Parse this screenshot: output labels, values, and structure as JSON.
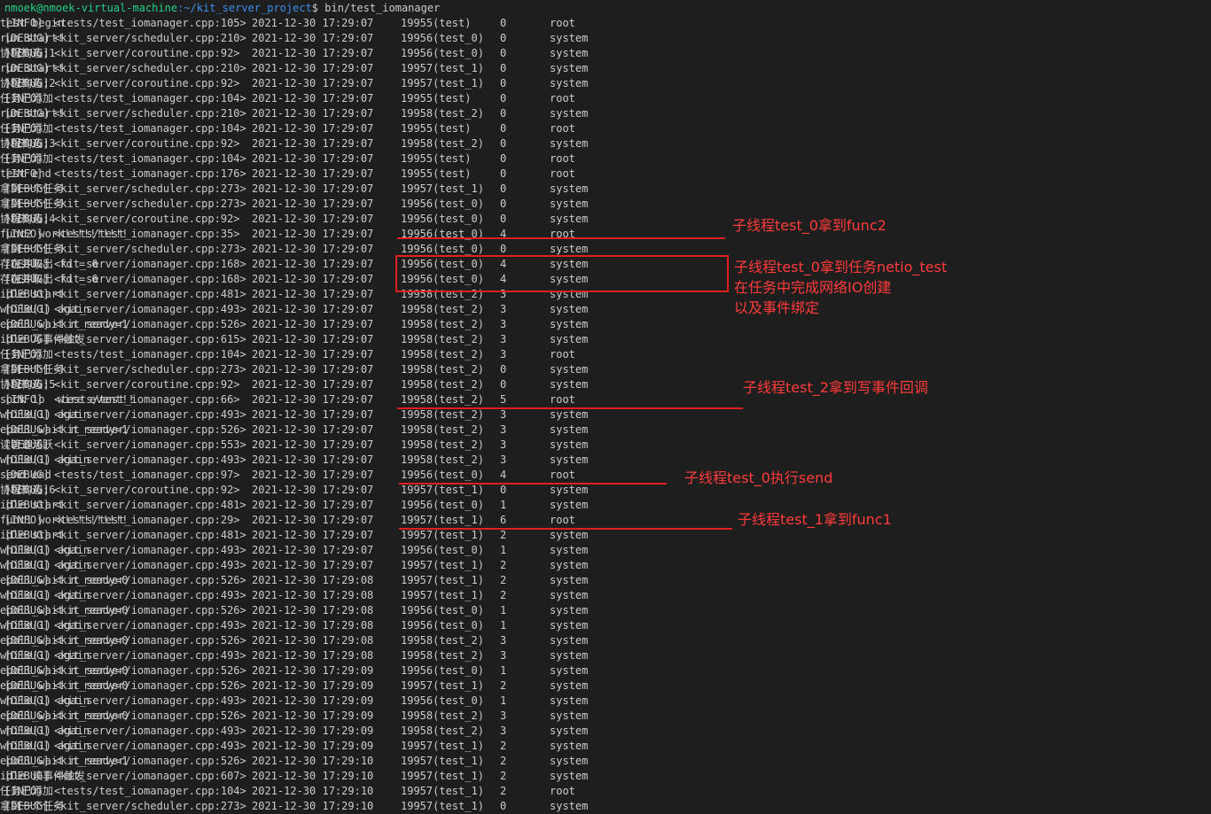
{
  "terminal": {
    "prompt": {
      "user_host": "nmoek@nmoek-virtual-machine",
      "path": ":~/kit_server_project",
      "command": "$ bin/test_iomanager"
    },
    "lines": [
      {
        "level": "[INFO]",
        "source": "<tests/test_iomanager.cpp:105>",
        "time": "2021-12-30 17:29:07",
        "thread": "19955(test)",
        "fiber": "0",
        "logger": "root",
        "message": "test begin"
      },
      {
        "level": "[DEBUG]",
        "source": "<kit_server/scheduler.cpp:210>",
        "time": "2021-12-30 17:29:07",
        "thread": "19956(test_0)",
        "fiber": "0",
        "logger": "system",
        "message": "run start!"
      },
      {
        "level": "[DEBUG]",
        "source": "<kit_server/coroutine.cpp:92>",
        "time": "2021-12-30 17:29:07",
        "thread": "19956(test_0)",
        "fiber": "0",
        "logger": "system",
        "message": "协程构造:1"
      },
      {
        "level": "[DEBUG]",
        "source": "<kit_server/scheduler.cpp:210>",
        "time": "2021-12-30 17:29:07",
        "thread": "19957(test_1)",
        "fiber": "0",
        "logger": "system",
        "message": "run start!"
      },
      {
        "level": "[DEBUG]",
        "source": "<kit_server/coroutine.cpp:92>",
        "time": "2021-12-30 17:29:07",
        "thread": "19957(test_1)",
        "fiber": "0",
        "logger": "system",
        "message": "协程构造:2"
      },
      {
        "level": "[INFO]",
        "source": "<tests/test_iomanager.cpp:104>",
        "time": "2021-12-30 17:29:07",
        "thread": "19955(test)",
        "fiber": "0",
        "logger": "root",
        "message": "任务已添加"
      },
      {
        "level": "[DEBUG]",
        "source": "<kit_server/scheduler.cpp:210>",
        "time": "2021-12-30 17:29:07",
        "thread": "19958(test_2)",
        "fiber": "0",
        "logger": "system",
        "message": "run start!"
      },
      {
        "level": "[INFO]",
        "source": "<tests/test_iomanager.cpp:104>",
        "time": "2021-12-30 17:29:07",
        "thread": "19955(test)",
        "fiber": "0",
        "logger": "root",
        "message": "任务已添加"
      },
      {
        "level": "[DEBUG]",
        "source": "<kit_server/coroutine.cpp:92>",
        "time": "2021-12-30 17:29:07",
        "thread": "19958(test_2)",
        "fiber": "0",
        "logger": "system",
        "message": "协程构造:3"
      },
      {
        "level": "[INFO]",
        "source": "<tests/test_iomanager.cpp:104>",
        "time": "2021-12-30 17:29:07",
        "thread": "19955(test)",
        "fiber": "0",
        "logger": "root",
        "message": "任务已添加"
      },
      {
        "level": "[INFO]",
        "source": "<tests/test_iomanager.cpp:176>",
        "time": "2021-12-30 17:29:07",
        "thread": "19955(test)",
        "fiber": "0",
        "logger": "root",
        "message": "test end"
      },
      {
        "level": "[DEBUG]",
        "source": "<kit_server/scheduler.cpp:273>",
        "time": "2021-12-30 17:29:07",
        "thread": "19957(test_1)",
        "fiber": "0",
        "logger": "system",
        "message": "拿到一个任务"
      },
      {
        "level": "[DEBUG]",
        "source": "<kit_server/scheduler.cpp:273>",
        "time": "2021-12-30 17:29:07",
        "thread": "19956(test_0)",
        "fiber": "0",
        "logger": "system",
        "message": "拿到一个任务"
      },
      {
        "level": "[DEBUG]",
        "source": "<kit_server/coroutine.cpp:92>",
        "time": "2021-12-30 17:29:07",
        "thread": "19956(test_0)",
        "fiber": "0",
        "logger": "system",
        "message": "协程构造:4"
      },
      {
        "level": "[INFO]",
        "source": "<tests/test_iomanager.cpp:35>",
        "time": "2021-12-30 17:29:07",
        "thread": "19956(test_0)",
        "fiber": "4",
        "logger": "root",
        "message": "func2 work!!!!!!!!!!"
      },
      {
        "level": "[DEBUG]",
        "source": "<kit_server/scheduler.cpp:273>",
        "time": "2021-12-30 17:29:07",
        "thread": "19956(test_0)",
        "fiber": "0",
        "logger": "system",
        "message": "拿到一个任务"
      },
      {
        "level": "[DEBUG]",
        "source": "<kit_server/iomanager.cpp:168>",
        "time": "2021-12-30 17:29:07",
        "thread": "19956(test_0)",
        "fiber": "4",
        "logger": "system",
        "message": "存在并取出 fd = 6"
      },
      {
        "level": "[DEBUG]",
        "source": "<kit_server/iomanager.cpp:168>",
        "time": "2021-12-30 17:29:07",
        "thread": "19956(test_0)",
        "fiber": "4",
        "logger": "system",
        "message": "存在并取出 fd = 6"
      },
      {
        "level": "[DEBUG]",
        "source": "<kit_server/iomanager.cpp:481>",
        "time": "2021-12-30 17:29:07",
        "thread": "19958(test_2)",
        "fiber": "3",
        "logger": "system",
        "message": "idle start"
      },
      {
        "level": "[DEBUG]",
        "source": "<kit_server/iomanager.cpp:493>",
        "time": "2021-12-30 17:29:07",
        "thread": "19958(test_2)",
        "fiber": "3",
        "logger": "system",
        "message": "while(1) again"
      },
      {
        "level": "[DEBUG]",
        "source": "<kit_server/iomanager.cpp:526>",
        "time": "2021-12-30 17:29:07",
        "thread": "19958(test_2)",
        "fiber": "3",
        "logger": "system",
        "message": "epoll_wait n_ready=1"
      },
      {
        "level": "[DEBUG]",
        "source": "<kit_server/iomanager.cpp:615>",
        "time": "2021-12-30 17:29:07",
        "thread": "19958(test_2)",
        "fiber": "3",
        "logger": "system",
        "message": "idle 写事件触发"
      },
      {
        "level": "[INFO]",
        "source": "<tests/test_iomanager.cpp:104>",
        "time": "2021-12-30 17:29:07",
        "thread": "19958(test_2)",
        "fiber": "3",
        "logger": "root",
        "message": "任务已添加"
      },
      {
        "level": "[DEBUG]",
        "source": "<kit_server/scheduler.cpp:273>",
        "time": "2021-12-30 17:29:07",
        "thread": "19958(test_2)",
        "fiber": "0",
        "logger": "system",
        "message": "拿到一个任务"
      },
      {
        "level": "[DEBUG]",
        "source": "<kit_server/coroutine.cpp:92>",
        "time": "2021-12-30 17:29:07",
        "thread": "19958(test_2)",
        "fiber": "0",
        "logger": "system",
        "message": "协程构造:5"
      },
      {
        "level": "[INFO]",
        "source": "<tests/test_iomanager.cpp:66>",
        "time": "2021-12-30 17:29:07",
        "thread": "19958(test_2)",
        "fiber": "5",
        "logger": "root",
        "message": "sock io  wire event!!"
      },
      {
        "level": "[DEBUG]",
        "source": "<kit_server/iomanager.cpp:493>",
        "time": "2021-12-30 17:29:07",
        "thread": "19958(test_2)",
        "fiber": "3",
        "logger": "system",
        "message": "while(1) again"
      },
      {
        "level": "[DEBUG]",
        "source": "<kit_server/iomanager.cpp:526>",
        "time": "2021-12-30 17:29:07",
        "thread": "19958(test_2)",
        "fiber": "3",
        "logger": "system",
        "message": "epoll_wait n_ready=1"
      },
      {
        "level": "[DEBUG]",
        "source": "<kit_server/iomanager.cpp:553>",
        "time": "2021-12-30 17:29:07",
        "thread": "19958(test_2)",
        "fiber": "3",
        "logger": "system",
        "message": "读管道活跃"
      },
      {
        "level": "[DEBUG]",
        "source": "<kit_server/iomanager.cpp:493>",
        "time": "2021-12-30 17:29:07",
        "thread": "19958(test_2)",
        "fiber": "3",
        "logger": "system",
        "message": "while(1) again"
      },
      {
        "level": "[DEBUG]",
        "source": "<tests/test_iomanager.cpp:97>",
        "time": "2021-12-30 17:29:07",
        "thread": "19956(test_0)",
        "fiber": "4",
        "logger": "root",
        "message": "send end"
      },
      {
        "level": "[DEBUG]",
        "source": "<kit_server/coroutine.cpp:92>",
        "time": "2021-12-30 17:29:07",
        "thread": "19957(test_1)",
        "fiber": "0",
        "logger": "system",
        "message": "协程构造:6"
      },
      {
        "level": "[DEBUG]",
        "source": "<kit_server/iomanager.cpp:481>",
        "time": "2021-12-30 17:29:07",
        "thread": "19956(test_0)",
        "fiber": "1",
        "logger": "system",
        "message": "idle start"
      },
      {
        "level": "[INFO]",
        "source": "<tests/test_iomanager.cpp:29>",
        "time": "2021-12-30 17:29:07",
        "thread": "19957(test_1)",
        "fiber": "6",
        "logger": "root",
        "message": "func1 work!!!!!!!!!!"
      },
      {
        "level": "[DEBUG]",
        "source": "<kit_server/iomanager.cpp:481>",
        "time": "2021-12-30 17:29:07",
        "thread": "19957(test_1)",
        "fiber": "2",
        "logger": "system",
        "message": "idle start"
      },
      {
        "level": "[DEBUG]",
        "source": "<kit_server/iomanager.cpp:493>",
        "time": "2021-12-30 17:29:07",
        "thread": "19956(test_0)",
        "fiber": "1",
        "logger": "system",
        "message": "while(1) again"
      },
      {
        "level": "[DEBUG]",
        "source": "<kit_server/iomanager.cpp:493>",
        "time": "2021-12-30 17:29:07",
        "thread": "19957(test_1)",
        "fiber": "2",
        "logger": "system",
        "message": "while(1) again"
      },
      {
        "level": "[DEBUG]",
        "source": "<kit_server/iomanager.cpp:526>",
        "time": "2021-12-30 17:29:08",
        "thread": "19957(test_1)",
        "fiber": "2",
        "logger": "system",
        "message": "epoll_wait n_ready=0"
      },
      {
        "level": "[DEBUG]",
        "source": "<kit_server/iomanager.cpp:493>",
        "time": "2021-12-30 17:29:08",
        "thread": "19957(test_1)",
        "fiber": "2",
        "logger": "system",
        "message": "while(1) again"
      },
      {
        "level": "[DEBUG]",
        "source": "<kit_server/iomanager.cpp:526>",
        "time": "2021-12-30 17:29:08",
        "thread": "19956(test_0)",
        "fiber": "1",
        "logger": "system",
        "message": "epoll_wait n_ready=0"
      },
      {
        "level": "[DEBUG]",
        "source": "<kit_server/iomanager.cpp:493>",
        "time": "2021-12-30 17:29:08",
        "thread": "19956(test_0)",
        "fiber": "1",
        "logger": "system",
        "message": "while(1) again"
      },
      {
        "level": "[DEBUG]",
        "source": "<kit_server/iomanager.cpp:526>",
        "time": "2021-12-30 17:29:08",
        "thread": "19958(test_2)",
        "fiber": "3",
        "logger": "system",
        "message": "epoll_wait n_ready=0"
      },
      {
        "level": "[DEBUG]",
        "source": "<kit_server/iomanager.cpp:493>",
        "time": "2021-12-30 17:29:08",
        "thread": "19958(test_2)",
        "fiber": "3",
        "logger": "system",
        "message": "while(1) again"
      },
      {
        "level": "[DEBUG]",
        "source": "<kit_server/iomanager.cpp:526>",
        "time": "2021-12-30 17:29:09",
        "thread": "19956(test_0)",
        "fiber": "1",
        "logger": "system",
        "message": "epoll_wait n_ready=0"
      },
      {
        "level": "[DEBUG]",
        "source": "<kit_server/iomanager.cpp:526>",
        "time": "2021-12-30 17:29:09",
        "thread": "19957(test_1)",
        "fiber": "2",
        "logger": "system",
        "message": "epoll_wait n_ready=0"
      },
      {
        "level": "[DEBUG]",
        "source": "<kit_server/iomanager.cpp:493>",
        "time": "2021-12-30 17:29:09",
        "thread": "19956(test_0)",
        "fiber": "1",
        "logger": "system",
        "message": "while(1) again"
      },
      {
        "level": "[DEBUG]",
        "source": "<kit_server/iomanager.cpp:526>",
        "time": "2021-12-30 17:29:09",
        "thread": "19958(test_2)",
        "fiber": "3",
        "logger": "system",
        "message": "epoll_wait n_ready=0"
      },
      {
        "level": "[DEBUG]",
        "source": "<kit_server/iomanager.cpp:493>",
        "time": "2021-12-30 17:29:09",
        "thread": "19958(test_2)",
        "fiber": "3",
        "logger": "system",
        "message": "while(1) again"
      },
      {
        "level": "[DEBUG]",
        "source": "<kit_server/iomanager.cpp:493>",
        "time": "2021-12-30 17:29:09",
        "thread": "19957(test_1)",
        "fiber": "2",
        "logger": "system",
        "message": "while(1) again"
      },
      {
        "level": "[DEBUG]",
        "source": "<kit_server/iomanager.cpp:526>",
        "time": "2021-12-30 17:29:10",
        "thread": "19957(test_1)",
        "fiber": "2",
        "logger": "system",
        "message": "epoll_wait n_ready=1"
      },
      {
        "level": "[DEBUG]",
        "source": "<kit_server/iomanager.cpp:607>",
        "time": "2021-12-30 17:29:10",
        "thread": "19957(test_1)",
        "fiber": "2",
        "logger": "system",
        "message": "idle 读事件触发"
      },
      {
        "level": "[INFO]",
        "source": "<tests/test_iomanager.cpp:104>",
        "time": "2021-12-30 17:29:10",
        "thread": "19957(test_1)",
        "fiber": "2",
        "logger": "root",
        "message": "任务已添加"
      },
      {
        "level": "[DEBUG]",
        "source": "<kit_server/scheduler.cpp:273>",
        "time": "2021-12-30 17:29:10",
        "thread": "19957(test_1)",
        "fiber": "0",
        "logger": "system",
        "message": "拿到一个任务"
      }
    ]
  },
  "annotations": {
    "test0_func2": "子线程test_0拿到func2",
    "test0_netio_1": "子线程test_0拿到任务netio_test",
    "test0_netio_2": "在任务中完成网络IO创建",
    "test0_netio_3": "以及事件绑定",
    "test2_write": "子线程test_2拿到写事件回调",
    "test0_send": "子线程test_0执行send",
    "test1_func1": "子线程test_1拿到func1"
  },
  "colors": {
    "background": "#1e1e1e",
    "text": "#cccccc",
    "prompt_user": "#23d18b",
    "prompt_path": "#3b8eea",
    "annotation": "#ff3b3b"
  }
}
